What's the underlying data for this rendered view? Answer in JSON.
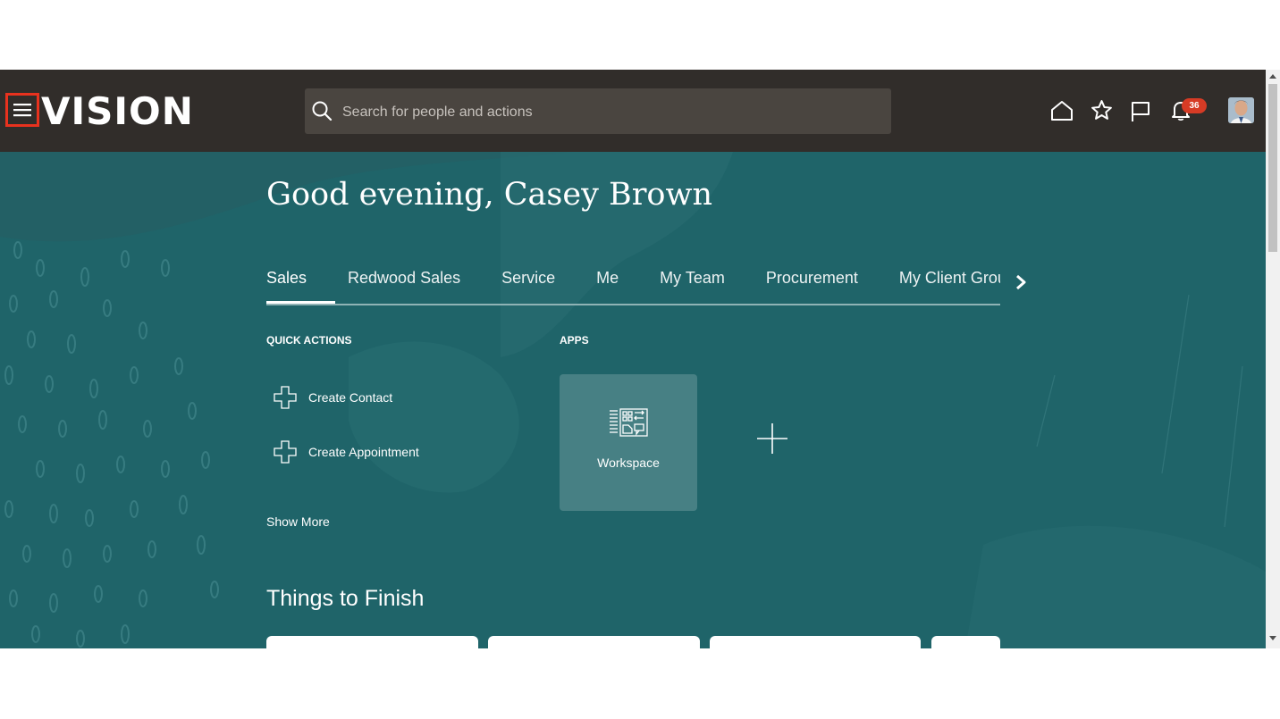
{
  "header": {
    "menu_icon": "hamburger-menu-icon",
    "logo_text": "VISION",
    "search": {
      "placeholder": "Search for people and actions",
      "value": ""
    },
    "icons": [
      "home-icon",
      "star-icon",
      "flag-icon",
      "bell-icon"
    ],
    "notification_count": "36",
    "colors": {
      "bar": "#312d2a",
      "badge": "#d63b25",
      "highlight": "#e8321e"
    }
  },
  "greeting": "Good evening, Casey Brown",
  "tabs": [
    {
      "label": "Sales",
      "active": true
    },
    {
      "label": "Redwood Sales",
      "active": false
    },
    {
      "label": "Service",
      "active": false
    },
    {
      "label": "Me",
      "active": false
    },
    {
      "label": "My Team",
      "active": false
    },
    {
      "label": "Procurement",
      "active": false
    },
    {
      "label": "My Client Grou",
      "active": false
    }
  ],
  "quick_actions": {
    "title": "QUICK ACTIONS",
    "items": [
      {
        "label": "Create Contact",
        "icon": "plus-outline-icon"
      },
      {
        "label": "Create Appointment",
        "icon": "plus-outline-icon"
      }
    ],
    "show_more": "Show More"
  },
  "apps": {
    "title": "APPS",
    "items": [
      {
        "label": "Workspace",
        "icon": "workspace-icon"
      }
    ],
    "add_icon": "plus-icon"
  },
  "things_to_finish": {
    "title": "Things to Finish"
  },
  "chat_icon": "chat-bubble-icon",
  "colors": {
    "hero": "#1f6469",
    "chat": "#d54f3a"
  }
}
